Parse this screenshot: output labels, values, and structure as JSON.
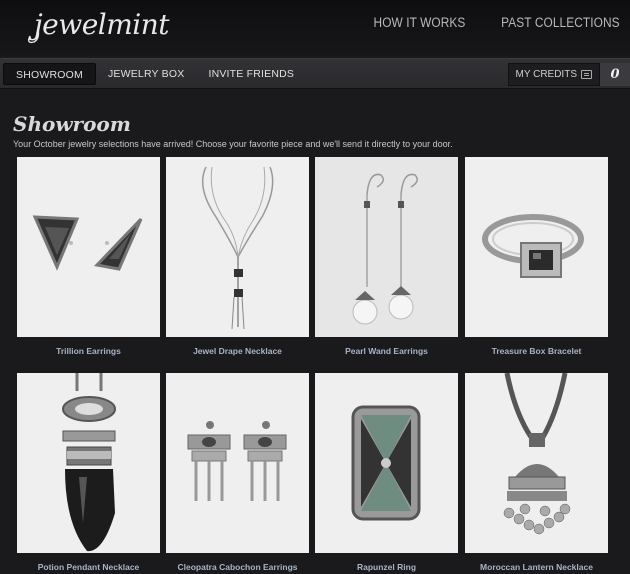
{
  "header": {
    "logo": "jewelmint",
    "nav": [
      "HOW IT WORKS",
      "PAST COLLECTIONS"
    ]
  },
  "subnav": {
    "tabs": [
      "SHOWROOM",
      "JEWELRY BOX",
      "INVITE FRIENDS"
    ],
    "active_tab": "SHOWROOM",
    "credits_label": "MY CREDITS",
    "credits_count": "0"
  },
  "main": {
    "title": "Showroom",
    "intro": "Your October jewelry selections have arrived! Choose your favorite piece and we'll send it directly to your door.",
    "products": [
      {
        "name": "Trillion Earrings",
        "icon": "earrings-icon"
      },
      {
        "name": "Jewel Drape Necklace",
        "icon": "necklace-icon"
      },
      {
        "name": "Pearl Wand Earrings",
        "icon": "earrings-icon"
      },
      {
        "name": "Treasure Box Bracelet",
        "icon": "bracelet-icon"
      },
      {
        "name": "Potion Pendant Necklace",
        "icon": "pendant-icon"
      },
      {
        "name": "Cleopatra Cabochon Earrings",
        "icon": "earrings-icon"
      },
      {
        "name": "Rapunzel Ring",
        "icon": "ring-icon"
      },
      {
        "name": "Moroccan Lantern Necklace",
        "icon": "necklace-icon"
      }
    ]
  },
  "colors": {
    "background": "#1a1a1c",
    "product_name": "#a7b4c6",
    "image_bg": "#efefef"
  }
}
